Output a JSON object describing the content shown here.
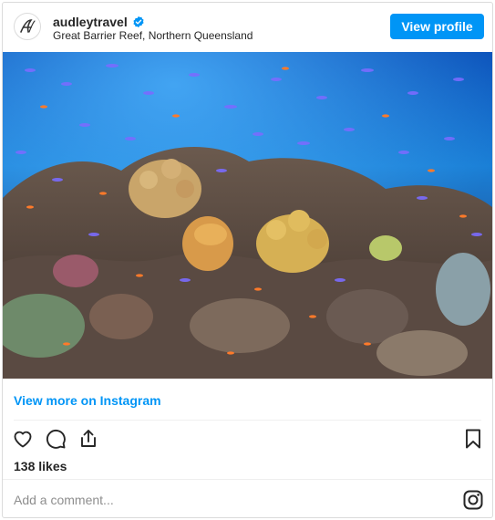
{
  "post": {
    "username": "audleytravel",
    "verified": true,
    "location": "Great Barrier Reef, Northern Queensland",
    "view_profile_label": "View profile",
    "image_alt": "Coral reef with schools of tropical fish",
    "view_more_label": "View more on Instagram",
    "likes_text": "138 likes",
    "comment_placeholder": "Add a comment..."
  },
  "icons": {
    "avatar": "audley-logo-icon",
    "verified": "verified-badge-icon",
    "like": "heart-icon",
    "comment": "comment-icon",
    "share": "share-icon",
    "save": "bookmark-icon",
    "instagram": "instagram-icon"
  },
  "colors": {
    "accent": "#0095f6",
    "border": "#dbdbdb",
    "text": "#262626",
    "muted": "#8e8e8e"
  }
}
